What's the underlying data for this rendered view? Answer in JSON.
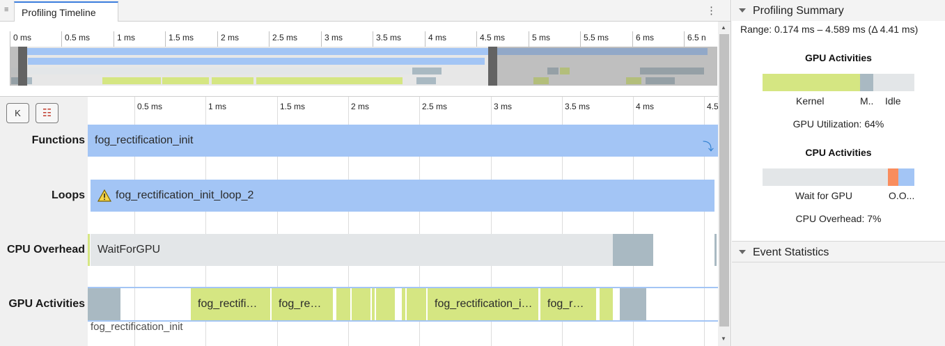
{
  "tab": {
    "title": "Profiling Timeline",
    "grip": "≡",
    "menu": "⋮"
  },
  "overview": {
    "ticks": [
      "0 ms",
      "0.5 ms",
      "1 ms",
      "1.5 ms",
      "2 ms",
      "2.5 ms",
      "3 ms",
      "3.5 ms",
      "4 ms",
      "4.5 ms",
      "5 ms",
      "5.5 ms",
      "6 ms",
      "6.5 n"
    ]
  },
  "toolbar": {
    "k_button": "K",
    "legend_button": "☷"
  },
  "timeline": {
    "ticks": [
      "0.5 ms",
      "1 ms",
      "1.5 ms",
      "2 ms",
      "2.5 ms",
      "3 ms",
      "3.5 ms",
      "4 ms",
      "4.5"
    ],
    "rows": {
      "functions": {
        "label": "Functions",
        "bar": "fog_rectification_init"
      },
      "loops": {
        "label": "Loops",
        "bar": "fog_rectification_init_loop_2"
      },
      "cpu_overhead": {
        "label": "CPU Overhead",
        "bar": "WaitForGPU"
      },
      "gpu_activities": {
        "label": "GPU Activities",
        "segments": [
          "fog_rectifi…",
          "fog_re…",
          "fog_rectification_i…",
          "fog_r…"
        ],
        "subtitle": "fog_rectification_init"
      }
    }
  },
  "summary": {
    "header": "Profiling Summary",
    "range": "Range: 0.174 ms – 4.589 ms (Δ 4.41 ms)",
    "gpu": {
      "title": "GPU Activities",
      "labels": [
        "Kernel",
        "M..",
        "Idle"
      ],
      "utilization": "GPU Utilization: 64%"
    },
    "cpu": {
      "title": "CPU Activities",
      "labels": [
        "Wait for GPU",
        "O.O..."
      ],
      "overhead": "CPU Overhead: 7%"
    }
  },
  "event_stats": {
    "header": "Event Statistics"
  },
  "colors": {
    "accent": "#3b7ddd",
    "function_bar": "#a3c5f5",
    "kernel": "#d5e682",
    "memory": "#a9b9c2",
    "idle": "#e3e6e8",
    "overhead": "#f98d5e"
  }
}
